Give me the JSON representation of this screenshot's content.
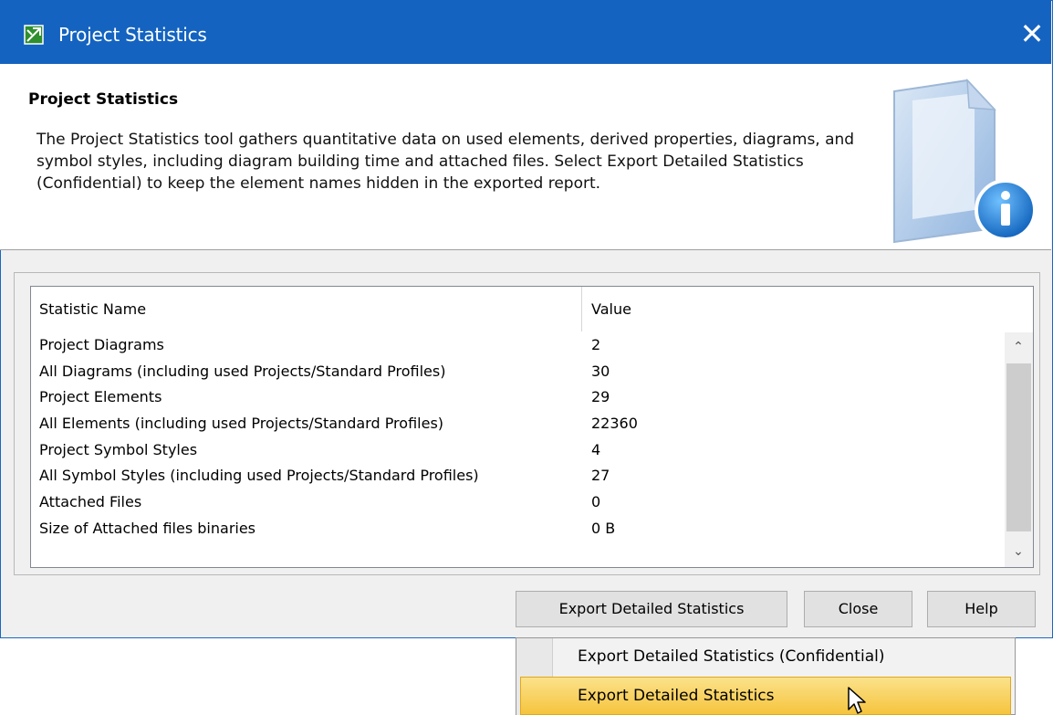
{
  "window": {
    "title": "Project Statistics",
    "close_glyph": "✕",
    "icon": "app-logo-icon"
  },
  "header": {
    "title": "Project Statistics",
    "description": "The Project Statistics tool gathers quantitative data on used elements, derived properties, diagrams, and symbol styles, including diagram building time and attached files. Select Export Detailed Statistics (Confidential) to keep the element names hidden in the exported report.",
    "graphic": "document-info-icon"
  },
  "table": {
    "columns": [
      "Statistic Name",
      "Value"
    ],
    "rows": [
      {
        "name": "Project Diagrams",
        "value": "2"
      },
      {
        "name": "All Diagrams (including used Projects/Standard Profiles)",
        "value": "30"
      },
      {
        "name": "Project Elements",
        "value": "29"
      },
      {
        "name": "All Elements (including used Projects/Standard  Profiles)",
        "value": "22360"
      },
      {
        "name": "Project Symbol Styles",
        "value": "4"
      },
      {
        "name": "All Symbol Styles (including used Projects/Standard  Profiles)",
        "value": "27"
      },
      {
        "name": "Attached Files",
        "value": "0"
      },
      {
        "name": "Size of Attached files binaries",
        "value": "0 B"
      }
    ],
    "scroll_up_glyph": "⌃",
    "scroll_down_glyph": "⌄"
  },
  "buttons": {
    "export": "Export Detailed Statistics",
    "close": "Close",
    "help": "Help"
  },
  "menu": {
    "items": [
      {
        "label": "Export Detailed Statistics (Confidential)",
        "highlighted": false
      },
      {
        "label": "Export Detailed Statistics",
        "highlighted": true
      }
    ]
  },
  "colors": {
    "titlebar": "#1463c0",
    "highlight": "#f6c43d"
  }
}
